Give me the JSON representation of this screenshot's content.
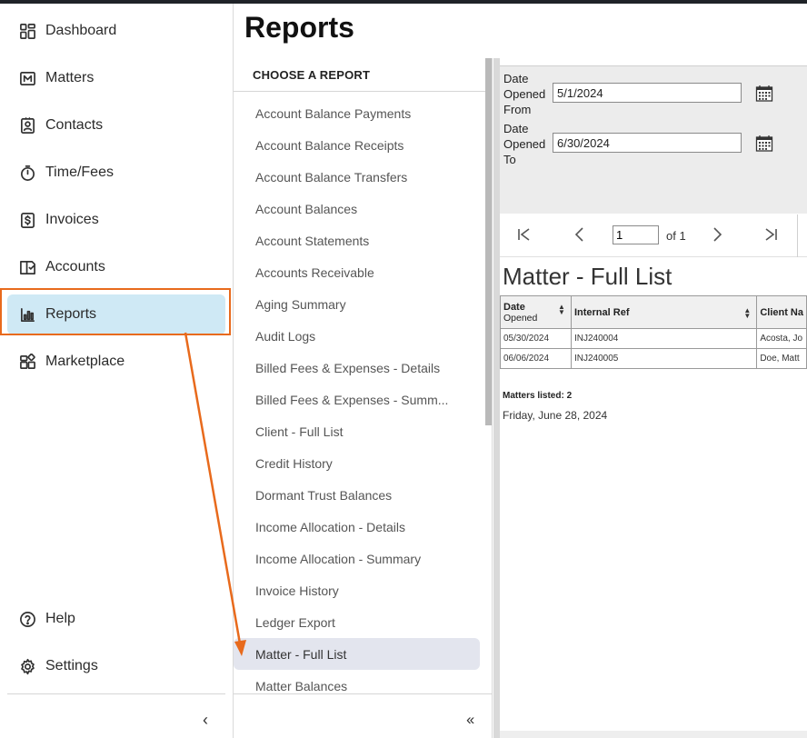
{
  "sidebar": {
    "items": [
      {
        "label": "Dashboard",
        "icon": "dashboard-icon"
      },
      {
        "label": "Matters",
        "icon": "matters-icon"
      },
      {
        "label": "Contacts",
        "icon": "contacts-icon"
      },
      {
        "label": "Time/Fees",
        "icon": "stopwatch-icon"
      },
      {
        "label": "Invoices",
        "icon": "invoice-dollar-icon"
      },
      {
        "label": "Accounts",
        "icon": "ledger-book-icon"
      },
      {
        "label": "Reports",
        "icon": "bar-chart-icon"
      },
      {
        "label": "Marketplace",
        "icon": "marketplace-icon"
      }
    ],
    "bottom_items": [
      {
        "label": "Help",
        "icon": "help-circle-icon"
      },
      {
        "label": "Settings",
        "icon": "gear-icon"
      }
    ],
    "active": "Reports",
    "collapse_glyph": "‹"
  },
  "page": {
    "title": "Reports"
  },
  "report_panel": {
    "header": "CHOOSE A REPORT",
    "items": [
      "Account Balance Payments",
      "Account Balance Receipts",
      "Account Balance Transfers",
      "Account Balances",
      "Account Statements",
      "Accounts Receivable",
      "Aging Summary",
      "Audit Logs",
      "Billed Fees & Expenses - Details",
      "Billed Fees & Expenses - Summ...",
      "Client - Full List",
      "Credit History",
      "Dormant Trust Balances",
      "Income Allocation - Details",
      "Income Allocation - Summary",
      "Invoice History",
      "Ledger Export",
      "Matter - Full List",
      "Matter Balances"
    ],
    "selected": "Matter - Full List",
    "collapse_glyph": "‹‹"
  },
  "viewer": {
    "params": {
      "from_label_lines": [
        "Date",
        "Opened",
        "From"
      ],
      "from_value": "5/1/2024",
      "to_label_lines": [
        "Date",
        "Opened",
        "To"
      ],
      "to_value": "6/30/2024"
    },
    "pager": {
      "page_value": "1",
      "of_text": "of 1"
    },
    "report_title": "Matter - Full List",
    "table": {
      "headers": [
        "Date Opened",
        "Internal Ref",
        "Client Na"
      ],
      "header_date_lines": [
        "Date",
        "Opened"
      ],
      "rows": [
        [
          "05/30/2024",
          "INJ240004",
          "Acosta, Jo"
        ],
        [
          "06/06/2024",
          "INJ240005",
          "Doe, Matt"
        ]
      ]
    },
    "matters_listed": "Matters listed: 2",
    "report_date": "Friday, June 28, 2024"
  },
  "colors": {
    "active_nav_bg": "#cfe9f5",
    "highlight_frame": "#e86a1c",
    "selected_report_bg": "#e3e5ee",
    "params_bg": "#ececec"
  }
}
